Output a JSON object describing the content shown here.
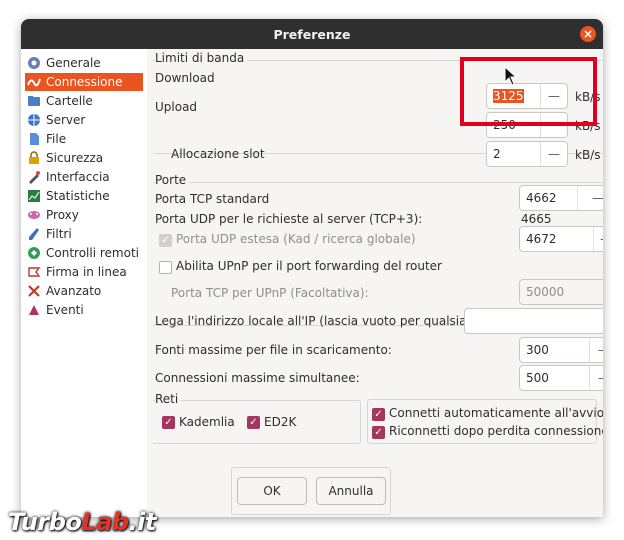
{
  "window": {
    "title": "Preferenze"
  },
  "sidebar": {
    "items": [
      {
        "label": "Generale",
        "icon": "general-icon"
      },
      {
        "label": "Connessione",
        "icon": "connection-icon",
        "selected": true
      },
      {
        "label": "Cartelle",
        "icon": "folder-icon"
      },
      {
        "label": "Server",
        "icon": "server-icon"
      },
      {
        "label": "File",
        "icon": "file-icon"
      },
      {
        "label": "Sicurezza",
        "icon": "lock-icon"
      },
      {
        "label": "Interfaccia",
        "icon": "interface-icon"
      },
      {
        "label": "Statistiche",
        "icon": "statistics-icon"
      },
      {
        "label": "Proxy",
        "icon": "proxy-icon"
      },
      {
        "label": "Filtri",
        "icon": "filter-icon"
      },
      {
        "label": "Controlli remoti",
        "icon": "remote-icon"
      },
      {
        "label": "Firma in linea",
        "icon": "signature-icon"
      },
      {
        "label": "Avanzato",
        "icon": "advanced-icon"
      },
      {
        "label": "Eventi",
        "icon": "events-icon"
      }
    ]
  },
  "bandwidth": {
    "title": "Limiti di banda",
    "download_label": "Download",
    "download_value": "3125",
    "upload_label": "Upload",
    "upload_value": "250",
    "slot_label": "Allocazione slot",
    "slot_value": "2",
    "unit": "kB/s"
  },
  "ports": {
    "title": "Porte",
    "tcp_label": "Porta TCP standard",
    "tcp_value": "4662",
    "udp_server_label": "Porta UDP per le richieste al server (TCP+3):",
    "udp_server_value": "4665",
    "udp_ext_label": "Porta UDP estesa (Kad / ricerca globale)",
    "udp_ext_value": "4672",
    "upnp_label": "Abilita UPnP per il port forwarding del router",
    "upnp_tcp_label": "Porta TCP per UPnP (Facoltativa):",
    "upnp_tcp_value": "50000"
  },
  "bind_address": {
    "label": "Lega l'indirizzo locale all'IP (lascia vuoto per qualsiasi):",
    "value": ""
  },
  "max_sources": {
    "label": "Fonti massime per file in scaricamento:",
    "value": "300"
  },
  "max_connections": {
    "label": "Connessioni massime simultanee:",
    "value": "500"
  },
  "networks": {
    "title": "Reti",
    "kademlia": "Kademlia",
    "ed2k": "ED2K",
    "autoconnect": "Connetti automaticamente all'avvio",
    "reconnect": "Riconnetti dopo perdita connessione"
  },
  "buttons": {
    "ok": "OK",
    "cancel": "Annulla"
  },
  "spin_minus": "—",
  "watermark": {
    "part1": "Turbo",
    "part2": "Lab",
    "part3": ".it"
  }
}
